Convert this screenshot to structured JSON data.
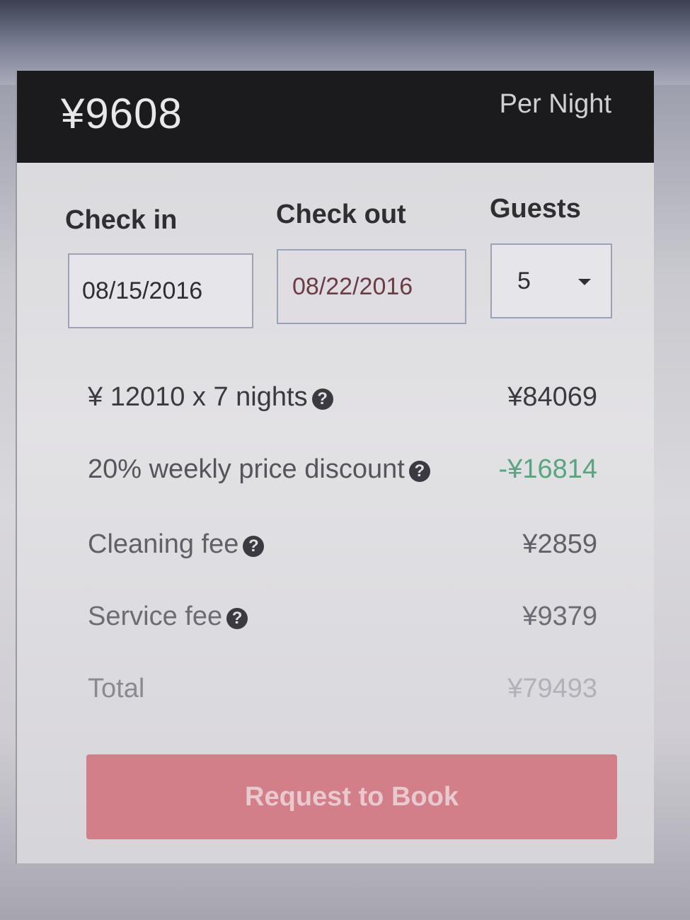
{
  "price_header": {
    "nightly_price": "¥9608",
    "per_night_label": "Per Night"
  },
  "booking_fields": {
    "check_in_label": "Check in",
    "check_out_label": "Check out",
    "guests_label": "Guests",
    "check_in_value": "08/15/2016",
    "check_out_value": "08/22/2016",
    "guests_value": "5"
  },
  "price_breakdown": [
    {
      "label": "¥ 12010 x 7 nights",
      "value": "¥84069",
      "has_help": true
    },
    {
      "label": "20% weekly price discount",
      "value": "-¥16814",
      "has_help": true
    },
    {
      "label": "Cleaning fee",
      "value": "¥2859",
      "has_help": true
    },
    {
      "label": "Service fee",
      "value": "¥9379",
      "has_help": true
    },
    {
      "label": "Total",
      "value": "¥79493",
      "has_help": false
    }
  ],
  "help_glyph": "?",
  "book_button_label": "Request to Book",
  "colors": {
    "header_bg": "#1b1b1d",
    "discount_green": "#5aa581",
    "book_button": "#d37f89"
  }
}
